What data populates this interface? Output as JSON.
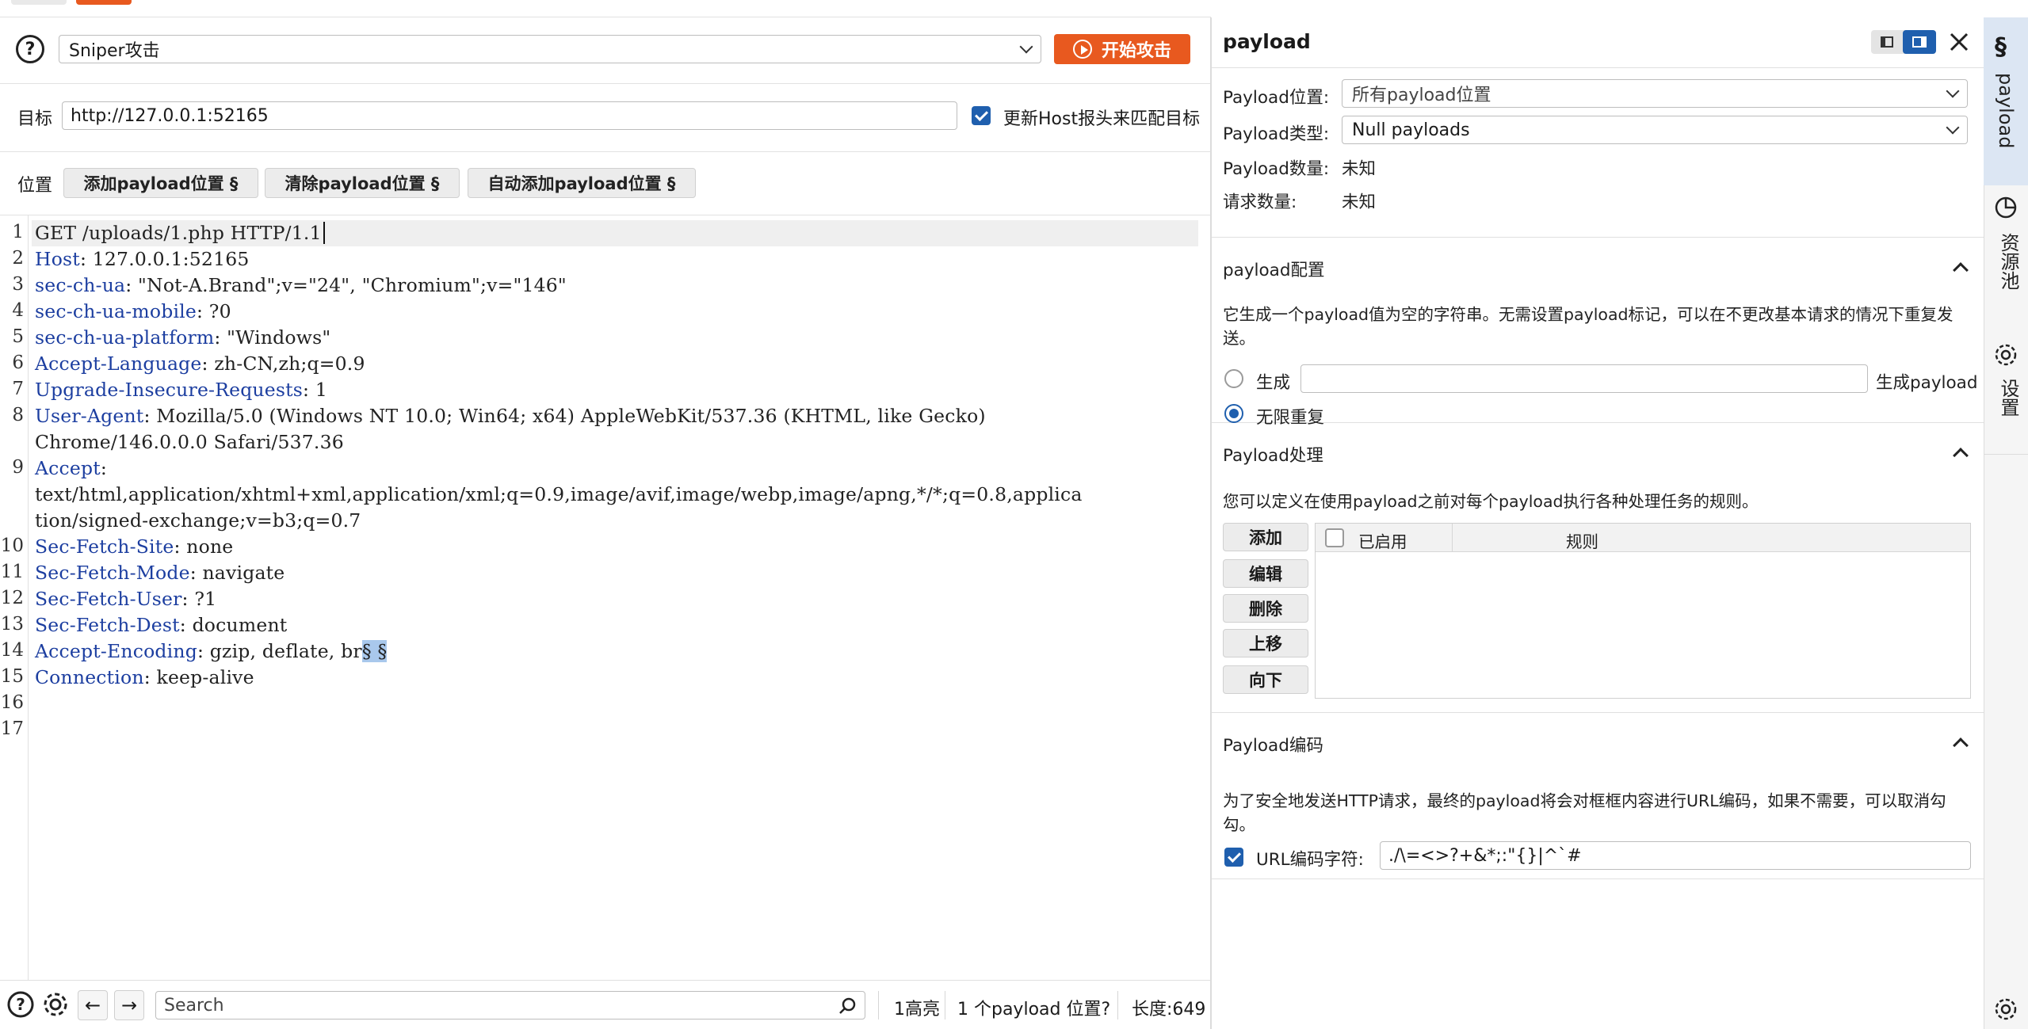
{
  "attack": {
    "mode": "Sniper攻击",
    "start_label": "开始攻击"
  },
  "target": {
    "label": "目标",
    "url": "http://127.0.0.1:52165",
    "update_host_label": "更新Host报头来匹配目标"
  },
  "positions": {
    "label": "位置",
    "add_label": "添加payload位置 §",
    "clear_label": "清除payload位置 §",
    "auto_label": "自动添加payload位置 §"
  },
  "request_lines": [
    {
      "n": "1",
      "key": "",
      "val": "GET /uploads/1.php HTTP/1.1"
    },
    {
      "n": "2",
      "key": "Host",
      "val": ": 127.0.0.1:52165"
    },
    {
      "n": "3",
      "key": "sec-ch-ua",
      "val": ": \"Not-A.Brand\";v=\"24\", \"Chromium\";v=\"146\""
    },
    {
      "n": "4",
      "key": "sec-ch-ua-mobile",
      "val": ": ?0"
    },
    {
      "n": "5",
      "key": "sec-ch-ua-platform",
      "val": ": \"Windows\""
    },
    {
      "n": "6",
      "key": "Accept-Language",
      "val": ": zh-CN,zh;q=0.9"
    },
    {
      "n": "7",
      "key": "Upgrade-Insecure-Requests",
      "val": ": 1"
    },
    {
      "n": "8",
      "key": "User-Agent",
      "val": ": Mozilla/5.0 (Windows NT 10.0; Win64; x64) AppleWebKit/537.36 (KHTML, like Gecko)"
    },
    {
      "n": "",
      "key": "",
      "val": "Chrome/146.0.0.0 Safari/537.36"
    },
    {
      "n": "9",
      "key": "Accept",
      "val": ":"
    },
    {
      "n": "",
      "key": "",
      "val": "text/html,application/xhtml+xml,application/xml;q=0.9,image/avif,image/webp,image/apng,*/*;q=0.8,applica"
    },
    {
      "n": "",
      "key": "",
      "val": "tion/signed-exchange;v=b3;q=0.7"
    },
    {
      "n": "10",
      "key": "Sec-Fetch-Site",
      "val": ": none"
    },
    {
      "n": "11",
      "key": "Sec-Fetch-Mode",
      "val": ": navigate"
    },
    {
      "n": "12",
      "key": "Sec-Fetch-User",
      "val": ": ?1"
    },
    {
      "n": "13",
      "key": "Sec-Fetch-Dest",
      "val": ": document"
    },
    {
      "n": "14",
      "key": "Accept-Encoding",
      "val": ": gzip, deflate, br",
      "marker": "§ §"
    },
    {
      "n": "15",
      "key": "Connection",
      "val": ": keep-alive"
    },
    {
      "n": "16",
      "key": "",
      "val": ""
    },
    {
      "n": "17",
      "key": "",
      "val": ""
    }
  ],
  "bottom": {
    "search_placeholder": "Search",
    "highlights": "1高亮",
    "payload_positions": "1 个payload 位置?",
    "length": "长度:649"
  },
  "payload_panel": {
    "title": "payload",
    "position_label": "Payload位置:",
    "position_value": "所有payload位置",
    "type_label": "Payload类型:",
    "type_value": "Null payloads",
    "count_label": "Payload数量:",
    "count_value": "未知",
    "requests_label": "请求数量:",
    "requests_value": "未知"
  },
  "payload_config": {
    "title": "payload配置",
    "desc": "它生成一个payload值为空的字符串。无需设置payload标记，可以在不更改基本请求的情况下重复发送。",
    "generate_label": "生成",
    "generate_suffix": "生成payload",
    "infinite_label": "无限重复"
  },
  "payload_processing": {
    "title": "Payload处理",
    "desc": "您可以定义在使用payload之前对每个payload执行各种处理任务的规则。",
    "buttons": [
      "添加",
      "编辑",
      "删除",
      "上移",
      "向下"
    ],
    "col_enabled": "已启用",
    "col_rule": "规则"
  },
  "payload_encoding": {
    "title": "Payload编码",
    "desc": "为了安全地发送HTTP请求，最终的payload将会对框框内容进行URL编码，如果不需要，可以取消勾勾。",
    "url_encode_label": "URL编码字符:",
    "url_encode_chars": "./\\=<>?+&*;:\"{}|^`#"
  },
  "sidebar": {
    "payload_label": "payload",
    "resource_pool_label": "资源池",
    "settings_label": "设置"
  },
  "colors": {
    "accent_orange": "#e8591f",
    "accent_blue": "#1f5fae",
    "header_key_blue": "#1c3ea0"
  }
}
